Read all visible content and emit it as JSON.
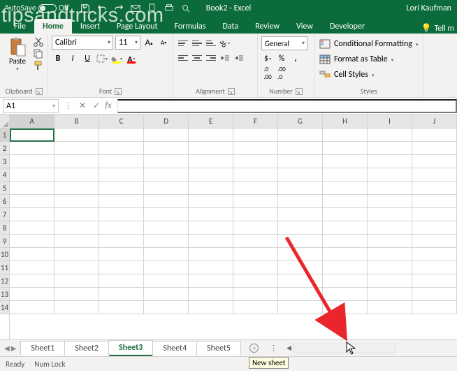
{
  "titlebar": {
    "autosave_label": "AutoSave",
    "autosave_state": "Off",
    "title": "Book2 - Excel",
    "user": "Lori Kaufman"
  },
  "tabs": {
    "items": [
      "File",
      "Home",
      "Insert",
      "Page Layout",
      "Formulas",
      "Data",
      "Review",
      "View",
      "Developer"
    ],
    "active": "Home",
    "tell_me": "Tell m"
  },
  "ribbon": {
    "clipboard": {
      "paste_label": "Paste",
      "group_label": "Clipboard"
    },
    "font": {
      "name": "Calibri",
      "size": "11",
      "group_label": "Font",
      "fill_color": "#ffff00",
      "font_color": "#ff0000"
    },
    "alignment": {
      "group_label": "Alignment"
    },
    "number": {
      "format": "General",
      "group_label": "Number"
    },
    "styles": {
      "conditional": "Conditional Formatting",
      "table": "Format as Table",
      "cell": "Cell Styles",
      "group_label": "Styles"
    }
  },
  "formula_bar": {
    "name_box": "A1",
    "value": ""
  },
  "grid": {
    "columns": [
      "A",
      "B",
      "C",
      "D",
      "E",
      "F",
      "G",
      "H",
      "I",
      "J"
    ],
    "rows": [
      1,
      2,
      3,
      4,
      5,
      6,
      7,
      8,
      9,
      10,
      11,
      12,
      13,
      14
    ],
    "selected_cell": "A1"
  },
  "sheets": {
    "tabs": [
      "Sheet1",
      "Sheet2",
      "Sheet3",
      "Sheet4",
      "Sheet5"
    ],
    "active": "Sheet3",
    "new_sheet_tooltip": "New sheet"
  },
  "status": {
    "ready": "Ready",
    "numlock": "Num Lock"
  },
  "watermark": "tipsandtricks.com"
}
